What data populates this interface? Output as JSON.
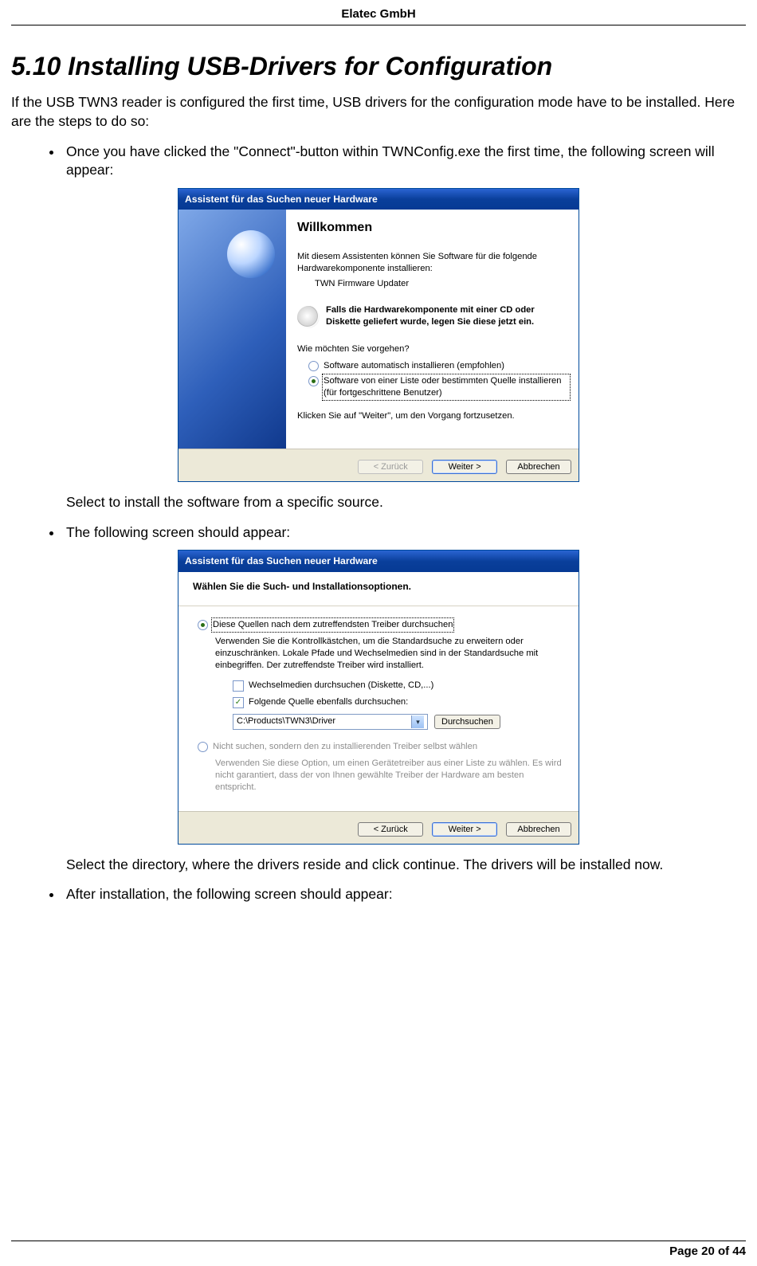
{
  "header": {
    "company": "Elatec GmbH"
  },
  "section": {
    "number": "5.10",
    "title": "Installing USB-Drivers for Configuration"
  },
  "intro": "If the USB TWN3 reader is configured the first time, USB drivers for the configuration mode have to be installed. Here are the steps to do so:",
  "bullets": [
    {
      "text": "Once you have clicked the \"Connect\"-button within TWNConfig.exe the first time, the following screen will appear:",
      "after": "Select to install the software from a specific source."
    },
    {
      "text": "The following screen should appear:",
      "after": "Select the directory, where the drivers reside and click continue. The drivers will be installed now."
    },
    {
      "text": "After installation, the following screen should appear:"
    }
  ],
  "wizard1": {
    "title": "Assistent für das Suchen neuer Hardware",
    "heading": "Willkommen",
    "p1": "Mit diesem Assistenten können Sie Software für die folgende Hardwarekomponente installieren:",
    "device": "TWN Firmware Updater",
    "cd_note": "Falls die Hardwarekomponente mit einer CD oder Diskette geliefert wurde, legen Sie diese jetzt ein.",
    "q": "Wie möchten Sie vorgehen?",
    "opt_auto": "Software automatisch installieren (empfohlen)",
    "opt_list": "Software von einer Liste oder bestimmten Quelle installieren (für fortgeschrittene Benutzer)",
    "cont": "Klicken Sie auf \"Weiter\", um den Vorgang fortzusetzen.",
    "back": "< Zurück",
    "next": "Weiter >",
    "cancel": "Abbrechen"
  },
  "wizard2": {
    "title": "Assistent für das Suchen neuer Hardware",
    "heading": "Wählen Sie die Such- und Installationsoptionen.",
    "opt_search": "Diese Quellen nach dem zutreffendsten Treiber durchsuchen",
    "search_note": "Verwenden Sie die Kontrollkästchen, um die Standardsuche zu erweitern oder einzuschränken. Lokale Pfade und Wechselmedien sind in der Standardsuche mit einbegriffen. Der zutreffendste Treiber wird installiert.",
    "chk_removable": "Wechselmedien durchsuchen (Diskette, CD,...)",
    "chk_path": "Folgende Quelle ebenfalls durchsuchen:",
    "path": "C:\\Products\\TWN3\\Driver",
    "browse": "Durchsuchen",
    "opt_manual": "Nicht suchen, sondern den zu installierenden Treiber selbst wählen",
    "manual_note": "Verwenden Sie diese Option, um einen Gerätetreiber aus einer Liste zu wählen. Es wird nicht garantiert, dass der von Ihnen gewählte Treiber der Hardware am besten entspricht.",
    "back": "< Zurück",
    "next": "Weiter >",
    "cancel": "Abbrechen"
  },
  "footer": {
    "page": "Page 20 of 44"
  }
}
